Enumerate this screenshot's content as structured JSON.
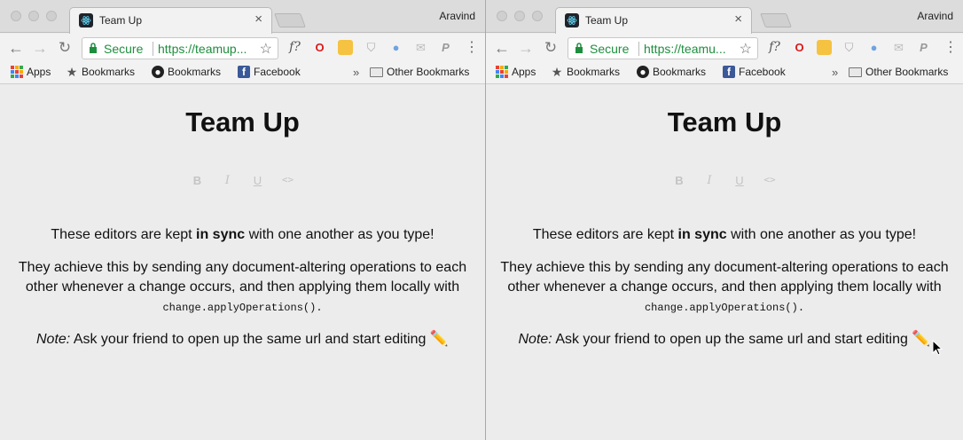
{
  "browser": {
    "tab_title": "Team Up",
    "tab_close": "×",
    "profile_name": "Aravind",
    "omnibox": {
      "secure_label": "Secure",
      "url_left": "https://teamup...",
      "url_right": "https://teamu..."
    },
    "bookmarks": {
      "apps": "Apps",
      "bookmarks_star": "Bookmarks",
      "bookmarks_github": "Bookmarks",
      "facebook": "Facebook",
      "more": "»",
      "other": "Other Bookmarks"
    },
    "extensions": {
      "f": "f?",
      "o": "O",
      "p": "P"
    }
  },
  "page": {
    "title": "Team Up",
    "format_buttons": {
      "bold": "B",
      "italic": "I",
      "underline": "U",
      "code": "<>"
    },
    "line1_before": "These editors are kept ",
    "line1_bold": "in sync",
    "line1_after": " with one another as you type!",
    "line2": "They achieve this by sending any document-altering operations to each other whenever a change occurs, and then applying them locally with ",
    "line2_code": "change.applyOperations()",
    "line2_end": ".",
    "note_label": "Note:",
    "note_text": " Ask your friend to open up the same url and start editing ",
    "note_emoji": "✏️"
  },
  "colors": {
    "secure_green": "#1e8e3e",
    "page_bg": "#ececec",
    "format_disabled": "#c4c4c4"
  }
}
